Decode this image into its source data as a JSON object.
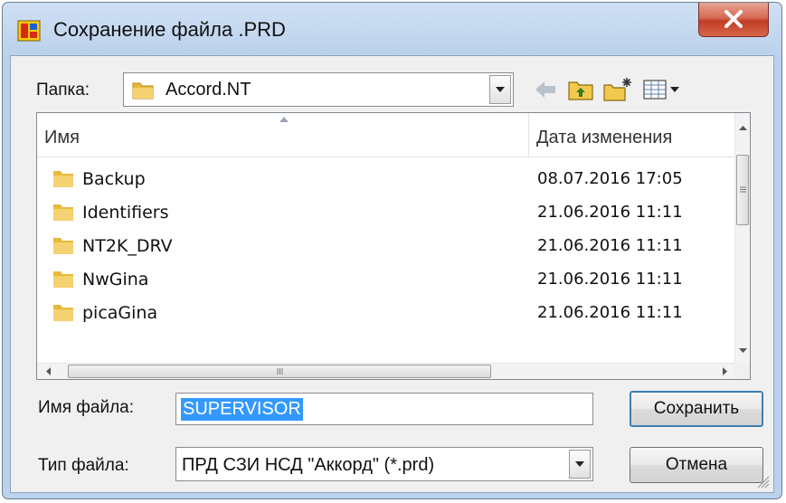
{
  "window": {
    "title": "Сохранение файла .PRD",
    "close_label": "x"
  },
  "folder": {
    "label": "Папка:",
    "value": "Accord.NT"
  },
  "toolbar": {
    "icons": [
      "back-arrow-icon",
      "up-folder-icon",
      "new-folder-icon",
      "view-menu-icon"
    ]
  },
  "file_list": {
    "columns": {
      "name": "Имя",
      "date": "Дата изменения"
    },
    "rows": [
      {
        "name": "Backup",
        "date": "08.07.2016 17:05"
      },
      {
        "name": "Identifiers",
        "date": "21.06.2016 11:11"
      },
      {
        "name": "NT2K_DRV",
        "date": "21.06.2016 11:11"
      },
      {
        "name": "NwGina",
        "date": "21.06.2016 11:11"
      },
      {
        "name": "picaGina",
        "date": "21.06.2016 11:11"
      }
    ]
  },
  "filename": {
    "label": "Имя файла:",
    "value": "SUPERVISOR"
  },
  "filetype": {
    "label": "Тип файла:",
    "value": "ПРД СЗИ НСД \"Аккорд\" (*.prd)"
  },
  "buttons": {
    "save": "Сохранить",
    "cancel": "Отмена"
  },
  "colors": {
    "selection": "#3399ff",
    "close_button": "#c9452c",
    "folder_icon": "#e8b93a"
  }
}
